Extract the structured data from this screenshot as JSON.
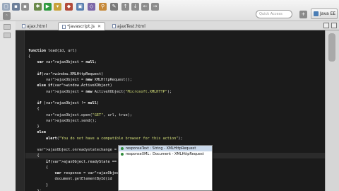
{
  "toolbar": {
    "search_placeholder": "Quick Access",
    "perspective_label": "Java EE"
  },
  "tabs": [
    {
      "label": "ajax.html",
      "active": false
    },
    {
      "label": "*javascript.js",
      "active": true
    },
    {
      "label": "ajaxTest.html",
      "active": false
    }
  ],
  "code_lines": [
    "function load(id, url)",
    "{",
    "    var ajaxObject = null;",
    "",
    "    if(window.XMLHttpRequest)",
    "        ajaxObject = new XMLHttpRequest();",
    "    else if(window.ActiveXObject)",
    "        ajaxObject = new ActiveXObject(\"Microsoft.XMLHTTP\");",
    "",
    "    if (ajaxObject != null)",
    "    {",
    "        ajaxObject.open(\"GET\", url, true);",
    "        ajaxObject.send();",
    "    }",
    "    else",
    "        alert(\"You do not have a compatible browser for this action\");",
    "",
    "    ajaxObject.onreadystatechange = function()",
    "    {",
    "        if(ajaxObject.readyState == 4 && ajaxObject.status == 200)",
    "        {",
    "            var response = ajaxObject.respon",
    "            document.getElementById(id",
    "        }",
    "    };",
    "}"
  ],
  "autocomplete": [
    {
      "label": "responseText : String - XMLHttpRequest",
      "selected": true
    },
    {
      "label": "responseXML : Document - XMLHttpRequest",
      "selected": false
    }
  ]
}
